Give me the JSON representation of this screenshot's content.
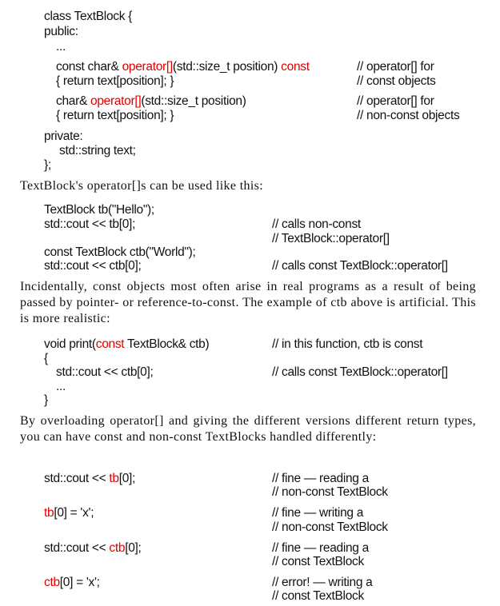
{
  "block1": {
    "l1": "class TextBlock {",
    "l2": "public:",
    "l3": "...",
    "op1_a": "const char& ",
    "op1_red1": "operator[]",
    "op1_b": "(std::size_t position) ",
    "op1_red2": "const",
    "op1_cmt1": "// operator[] for",
    "op1_body": "{ return text[position]; }",
    "op1_cmt2": "// const objects",
    "op2_a": "char& ",
    "op2_red": "operator[]",
    "op2_b": "(std::size_t position)",
    "op2_cmt1": "// operator[] for",
    "op2_body": "{ return text[position]; }",
    "op2_cmt2": "// non-const objects",
    "private": "private:",
    "member": "std::string text;",
    "close": "};"
  },
  "prose1": "TextBlock's operator[]s can be used like this:",
  "block2": {
    "l1": "TextBlock tb(\"Hello\");",
    "l2": "std::cout << tb[0];",
    "c2a": "// calls non-const",
    "c2b": "// TextBlock::operator[]",
    "l3": "const TextBlock ctb(\"World\");",
    "l4": "std::cout << ctb[0];",
    "c4": "// calls const TextBlock::operator[]"
  },
  "prose2": "Incidentally, const objects most often arise in real programs as a result of being passed by pointer- or reference-to-const. The example of ctb above is artificial. This is more realistic:",
  "block3": {
    "l1_a": "void print(",
    "l1_red": "const",
    "l1_b": " TextBlock& ctb)",
    "c1": "// in this function, ctb is const",
    "l2": "{",
    "l3": "std::cout << ctb[0];",
    "c3": "// calls const TextBlock::operator[]",
    "l4": "...",
    "l5": "}"
  },
  "prose3": "By overloading operator[] and giving the different versions different return types, you can have const and non-const TextBlocks handled differently:",
  "block4": {
    "r1_a": "std::cout << ",
    "r1_red": "tb",
    "r1_b": "[0];",
    "r1_c1": "// fine — reading a",
    "r1_c2": "// non-const TextBlock",
    "r2_red": "tb",
    "r2_b": "[0] = 'x';",
    "r2_c1": "// fine — writing a",
    "r2_c2": "// non-const TextBlock",
    "r3_a": "std::cout << ",
    "r3_red": "ctb",
    "r3_b": "[0];",
    "r3_c1": "// fine — reading a",
    "r3_c2": "// const TextBlock",
    "r4_red": "ctb",
    "r4_b": "[0] = 'x';",
    "r4_c1": "// error! — writing a",
    "r4_c2": "// const TextBlock"
  }
}
